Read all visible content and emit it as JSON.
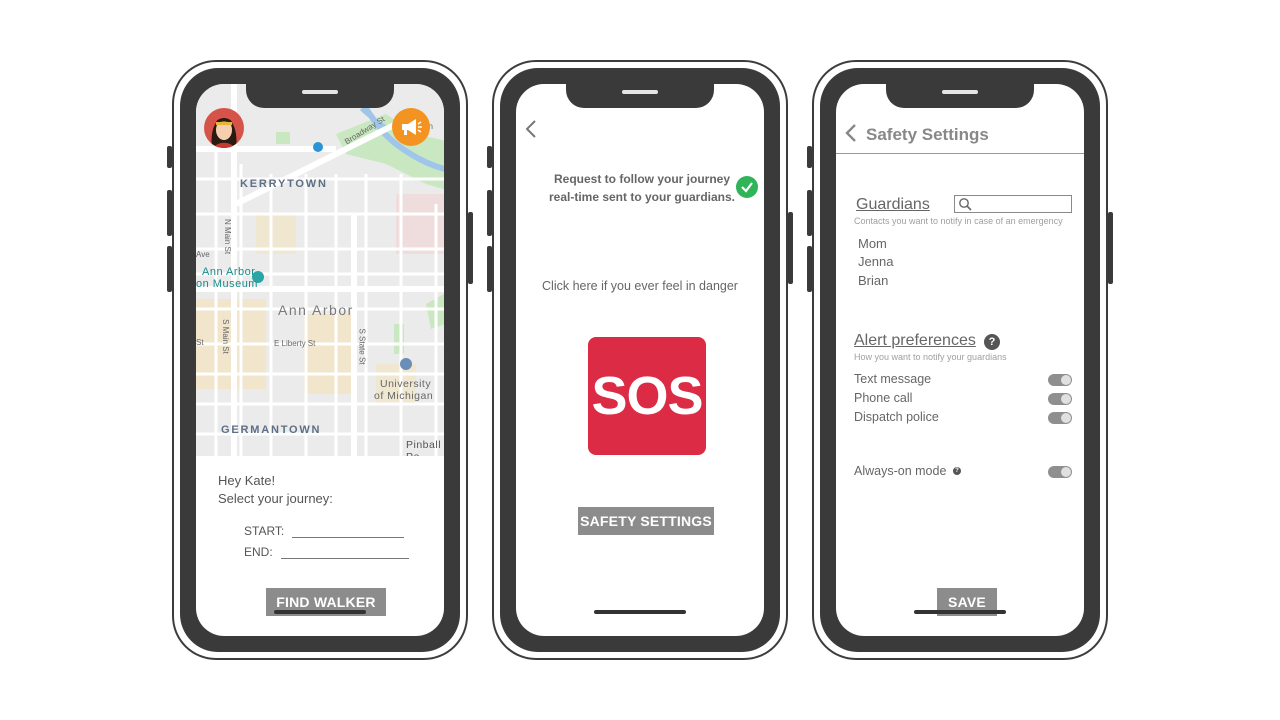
{
  "phone1": {
    "map": {
      "labels": {
        "kerrytown": "KERRYTOWN",
        "ann_arbor": "Ann Arbor",
        "germantown": "GERMANTOWN",
        "museum_line1": "Ann Arbor",
        "museum_line2": "on Museum",
        "university_line1": "University",
        "university_line2": "of Michigan",
        "pinball": "Pinball Pe",
        "broadway": "Broadway St",
        "liberty": "E Liberty St",
        "n_main": "N Main St",
        "s_main": "S Main St",
        "s_state": "S State St",
        "ave": "Ave",
        "st": "St",
        "ln": "Ln"
      }
    },
    "greeting_line1": "Hey Kate!",
    "greeting_line2": "Select your journey:",
    "start_label": "START:",
    "end_label": "END:",
    "find_walker_label": "FIND WALKER"
  },
  "phone2": {
    "status_message": "Request to follow your journey real-time sent to your guardians.",
    "danger_text": "Click here if you ever feel in danger",
    "sos_label": "SOS",
    "safety_settings_label": "SAFETY SETTINGS"
  },
  "phone3": {
    "title": "Safety Settings",
    "guardians": {
      "title": "Guardians",
      "subtitle": "Contacts you want to notify in case of an emergency",
      "items": [
        "Mom",
        "Jenna",
        "Brian"
      ]
    },
    "alerts": {
      "title": "Alert preferences",
      "subtitle": "How you want to notify your guardians",
      "items": [
        "Text message",
        "Phone call",
        "Dispatch police"
      ]
    },
    "always_on_label": "Always-on mode",
    "save_label": "SAVE"
  },
  "colors": {
    "sos_red": "#dc2c45",
    "check_green": "#2fb45a",
    "alert_orange": "#f39321",
    "button_gray": "#8c8c8c"
  }
}
